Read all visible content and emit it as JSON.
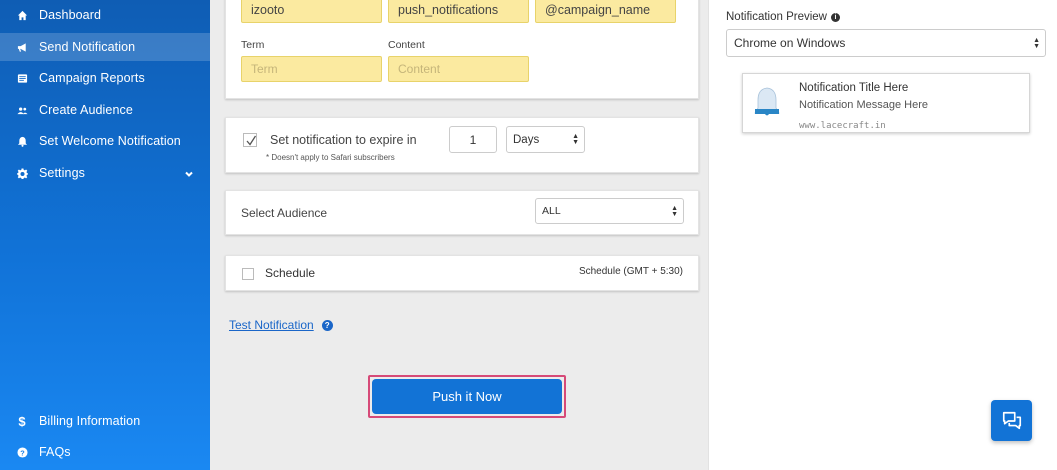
{
  "sidebar": {
    "items": [
      {
        "label": "Dashboard",
        "icon": "home-icon"
      },
      {
        "label": "Send Notification",
        "icon": "megaphone-icon",
        "active": true
      },
      {
        "label": "Campaign Reports",
        "icon": "reports-icon"
      },
      {
        "label": "Create Audience",
        "icon": "users-icon"
      },
      {
        "label": "Set Welcome Notification",
        "icon": "bell-icon"
      },
      {
        "label": "Settings",
        "icon": "gear-icon"
      }
    ],
    "bottom_items": [
      {
        "label": "Billing Information",
        "icon": "dollar-icon"
      },
      {
        "label": "FAQs",
        "icon": "question-icon"
      }
    ]
  },
  "utm": {
    "source_value": "izooto",
    "medium_value": "push_notifications",
    "campaign_value": "@campaign_name",
    "term_label": "Term",
    "term_placeholder": "Term",
    "content_label": "Content",
    "content_placeholder": "Content"
  },
  "expire": {
    "label": "Set notification to expire in",
    "note": "* Doesn't apply to Safari subscribers",
    "value": "1",
    "unit": "Days",
    "checked": true
  },
  "audience": {
    "label": "Select Audience",
    "value": "ALL"
  },
  "schedule": {
    "label": "Schedule",
    "timezone": "Schedule (GMT + 5:30)"
  },
  "test_link": "Test Notification",
  "push_button": "Push it Now",
  "preview": {
    "title": "Notification Preview",
    "browser": "Chrome on Windows",
    "notif_title": "Notification Title Here",
    "notif_message": "Notification Message Here",
    "notif_domain": "www.lacecraft.in"
  },
  "colors": {
    "sidebar": "#1173d8",
    "accent": "#1273d6",
    "highlight": "#d64a78",
    "field_yellow": "#fbeaa0"
  }
}
